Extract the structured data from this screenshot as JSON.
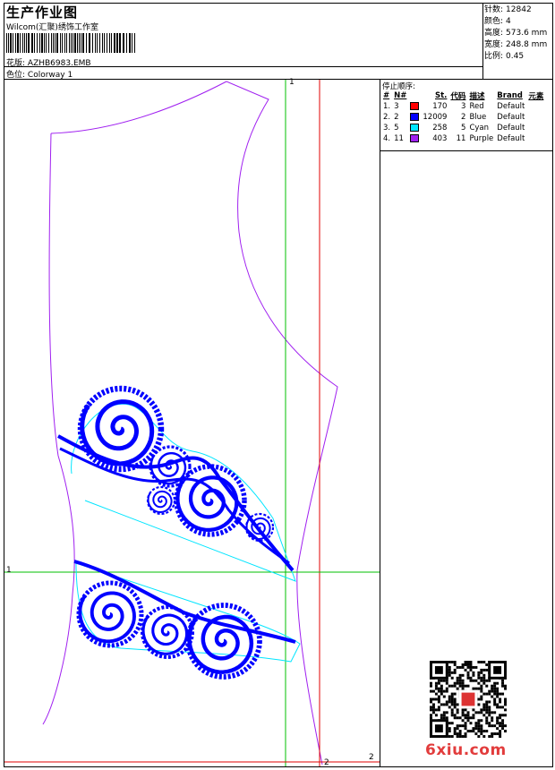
{
  "header": {
    "title": "生产作业图",
    "company": "Wilcom(汇聚)绣饰工作室",
    "design_label": "花版:",
    "design_value": "AZHB6983.EMB",
    "colorway_label": "色位:",
    "colorway_value": "Colorway 1"
  },
  "stats": {
    "stitches_label": "针数:",
    "stitches_value": "12842",
    "colors_label": "颜色:",
    "colors_value": "4",
    "height_label": "高度:",
    "height_value": "573.6 mm",
    "width_label": "宽度:",
    "width_value": "248.8 mm",
    "scale_label": "比例:",
    "scale_value": "0.45"
  },
  "stop_sequence": {
    "title": "停止顺序:",
    "columns": [
      "#",
      "N#",
      "",
      "St.",
      "代码",
      "描述",
      "Brand",
      "元素"
    ],
    "rows": [
      {
        "idx": "1.",
        "n": "3",
        "color": "#ff0000",
        "st": "170",
        "code": "3",
        "desc": "Red",
        "brand": "Default"
      },
      {
        "idx": "2.",
        "n": "2",
        "color": "#0000ff",
        "st": "12009",
        "code": "2",
        "desc": "Blue",
        "brand": "Default"
      },
      {
        "idx": "3.",
        "n": "5",
        "color": "#00e5ff",
        "st": "258",
        "code": "5",
        "desc": "Cyan",
        "brand": "Default"
      },
      {
        "idx": "4.",
        "n": "11",
        "color": "#a020f0",
        "st": "403",
        "code": "11",
        "desc": "Purple",
        "brand": "Default"
      }
    ]
  },
  "guides": {
    "vertical_top": "1",
    "horizontal_left": "1",
    "bottom_right": "2",
    "bottom_mid": "2"
  },
  "colors": {
    "outline": "#a020f0",
    "stitch": "#0000ff",
    "underlay": "#00e5ff",
    "guide_red": "#e00000",
    "guide_green": "#00c000"
  },
  "watermark": "6xiu.com"
}
